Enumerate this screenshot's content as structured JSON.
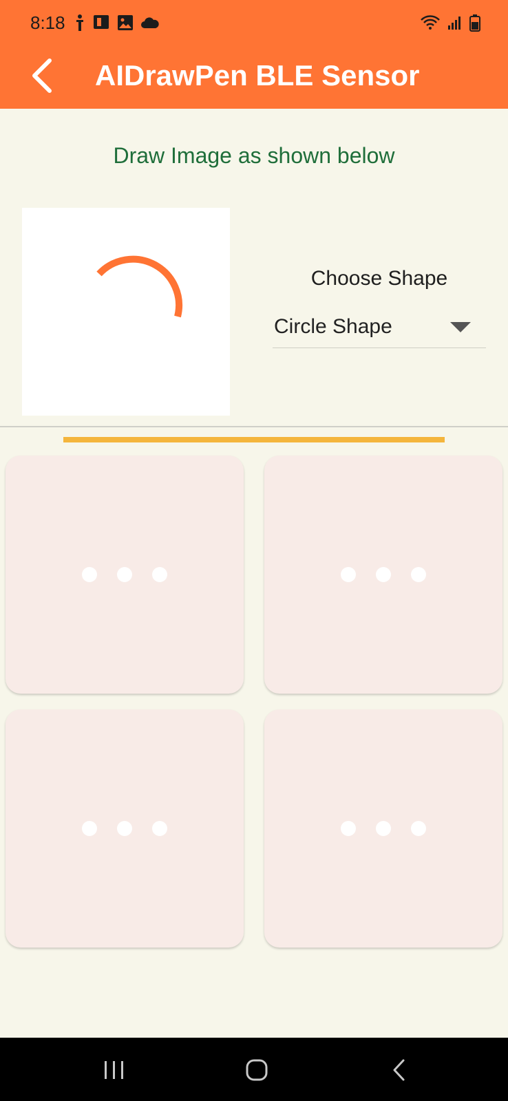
{
  "status_bar": {
    "time": "8:18",
    "left_icons": [
      "accessibility-icon",
      "notification-app-icon",
      "gallery-icon",
      "cloud-icon"
    ],
    "right_icons": [
      "wifi-icon",
      "signal-icon",
      "battery-icon"
    ]
  },
  "app_bar": {
    "title": "AIDrawPen BLE Sensor",
    "back_icon": "chevron-left-icon",
    "background_color": "#ff7434"
  },
  "main": {
    "instruction": "Draw Image as shown below",
    "preview": {
      "shape_icon": "arc-preview",
      "stroke_color": "#ff7434"
    },
    "shape_selector": {
      "label": "Choose Shape",
      "selected": "Circle Shape"
    },
    "progress_color": "#f4b53c",
    "cards": [
      {
        "state": "loading"
      },
      {
        "state": "loading"
      },
      {
        "state": "loading"
      },
      {
        "state": "loading"
      }
    ]
  },
  "nav_bar": {
    "buttons": [
      "recent-apps-icon",
      "home-icon",
      "back-icon"
    ]
  }
}
